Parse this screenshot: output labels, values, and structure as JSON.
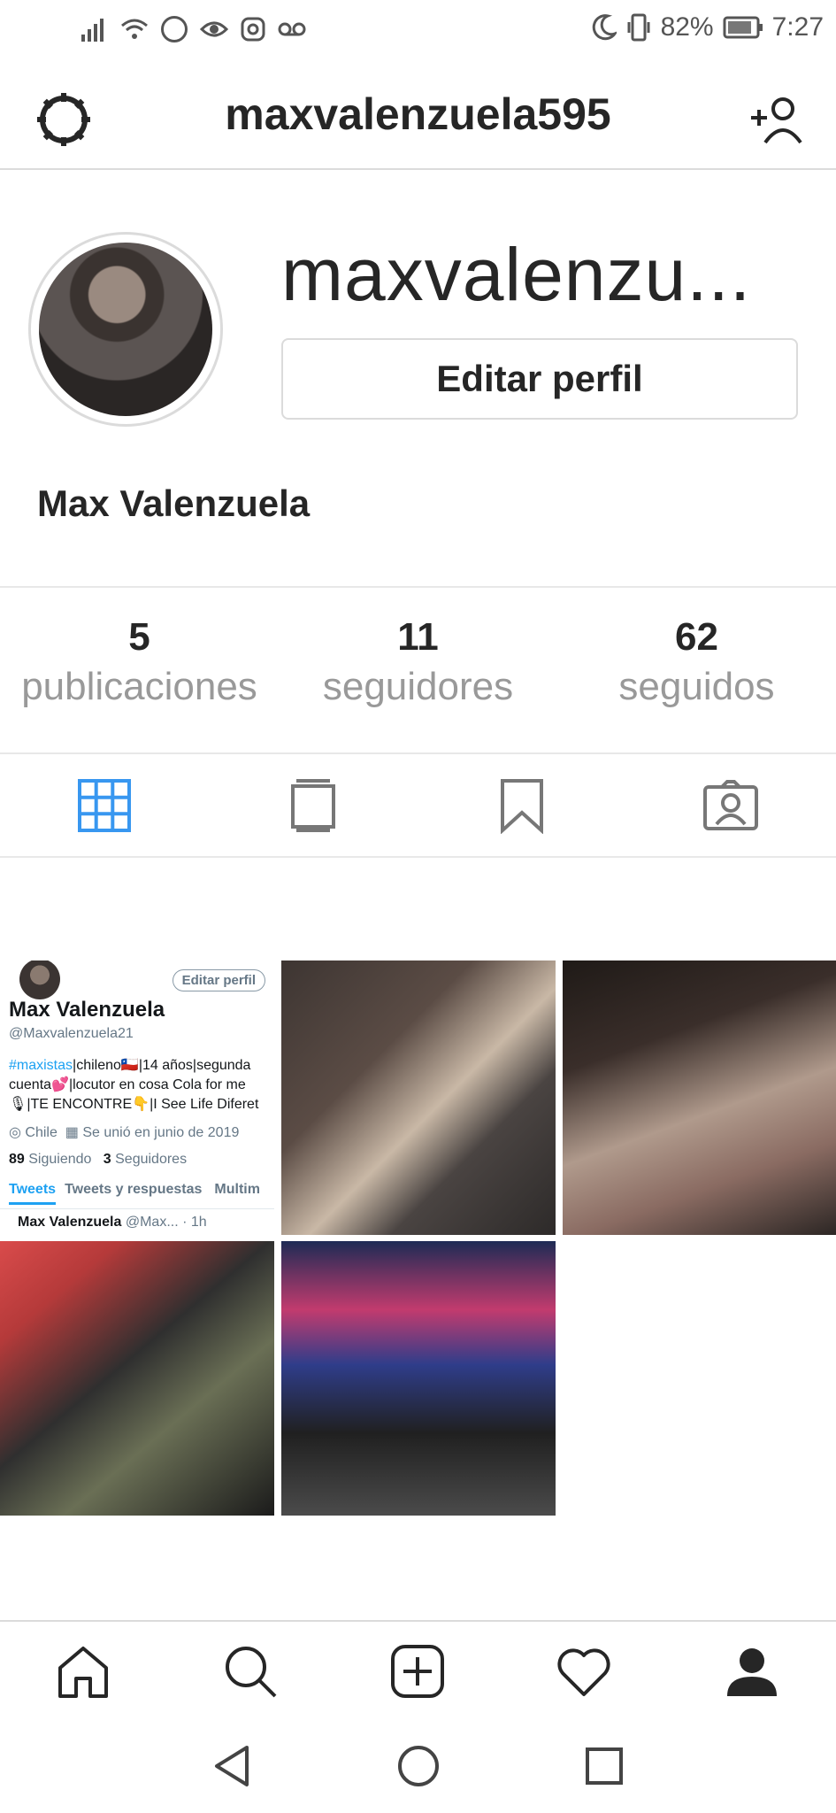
{
  "status_bar": {
    "battery": "82%",
    "time": "7:27"
  },
  "header": {
    "username": "maxvalenzuela595"
  },
  "profile": {
    "display_username": "maxvalenzu...",
    "edit_label": "Editar perfil",
    "full_name": "Max Valenzuela"
  },
  "stats": [
    {
      "value": "5",
      "label": "publicaciones"
    },
    {
      "value": "11",
      "label": "seguidores"
    },
    {
      "value": "62",
      "label": "seguidos"
    }
  ],
  "tabs": [
    {
      "icon": "grid-icon",
      "active": true
    },
    {
      "icon": "igtv-icon",
      "active": false
    },
    {
      "icon": "bookmark-icon",
      "active": false
    },
    {
      "icon": "tagged-icon",
      "active": false
    }
  ],
  "twitter_post": {
    "edit_label": "Editar perfil",
    "name": "Max Valenzuela",
    "handle": "@Maxvalenzuela21",
    "bio_tag": "#maxistas",
    "bio_rest": "|chileno🇨🇱|14 años|segunda cuenta💕|locutor en cosa Cola for me 🎙|TE ENCONTRE👇|I See Life Diferet",
    "location": "Chile",
    "joined": "Se unió en junio de 2019",
    "following_count": "89",
    "following_label": "Siguiendo",
    "followers_count": "3",
    "followers_label": "Seguidores",
    "tab_tweets": "Tweets",
    "tab_replies": "Tweets y respuestas",
    "tab_media": "Multim",
    "post_name": "Max Valenzuela",
    "post_meta": "@Max... · 1h"
  },
  "bottom_nav": [
    "home-icon",
    "search-icon",
    "add-post-icon",
    "activity-heart-icon",
    "profile-icon"
  ],
  "colors": {
    "accent": "#3897f0",
    "text": "#262626",
    "muted": "#999999",
    "border": "#dbdbdb"
  }
}
